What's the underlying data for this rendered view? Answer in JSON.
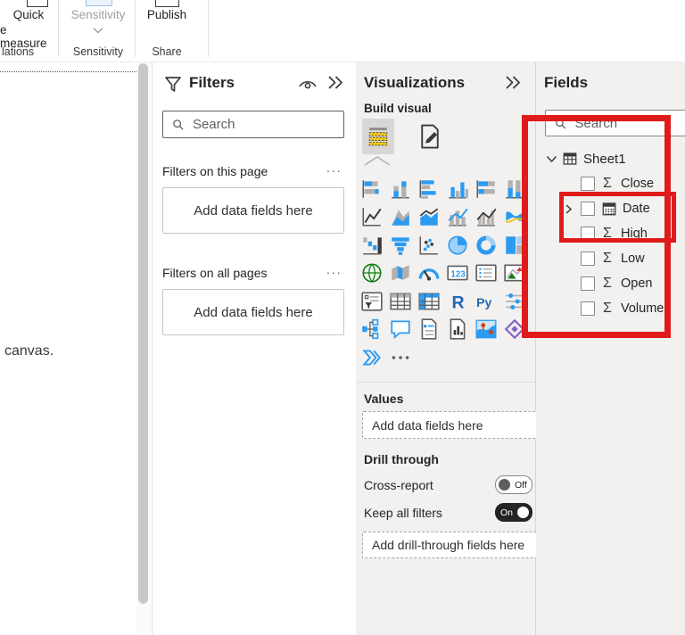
{
  "ribbon": {
    "quick_measure": {
      "line1": "Quick",
      "line2": "e measure"
    },
    "sensitivity_label": "Sensitivity",
    "publish_label": "Publish",
    "group_calculations": "lations",
    "group_sensitivity": "Sensitivity",
    "group_share": "Share"
  },
  "canvas": {
    "text": "canvas."
  },
  "filters": {
    "title": "Filters",
    "search_placeholder": "Search",
    "section_page": {
      "label": "Filters on this page",
      "more": "...",
      "dropzone": "Add data fields here"
    },
    "section_all": {
      "label": "Filters on all pages",
      "more": "...",
      "dropzone": "Add data fields here"
    }
  },
  "visualizations": {
    "title": "Visualizations",
    "build_visual_label": "Build visual",
    "tabs": [
      {
        "name": "build-visual-tab",
        "selected": true
      },
      {
        "name": "format-visual-tab",
        "selected": false
      }
    ],
    "gallery": [
      "stacked-bar-chart",
      "stacked-column-chart",
      "clustered-bar-chart",
      "clustered-column-chart",
      "pct-stacked-bar-chart",
      "pct-stacked-column-chart",
      "line-chart",
      "area-chart",
      "stacked-area-chart",
      "line-stacked-column-chart",
      "line-clustered-column-chart",
      "ribbon-chart",
      "waterfall-chart",
      "funnel-chart",
      "scatter-chart",
      "pie-chart",
      "donut-chart",
      "treemap",
      "map",
      "filled-map",
      "gauge",
      "card",
      "multi-row-card",
      "kpi",
      "slicer",
      "table",
      "matrix",
      "r-script-visual",
      "python-visual",
      "key-influencers",
      "decomposition-tree",
      "qa-visual",
      "smart-narrative",
      "paginated-report",
      "arcgis-map",
      "power-apps",
      "power-automate",
      "more-visuals"
    ],
    "values_label": "Values",
    "values_dropzone": "Add data fields here",
    "drill_through_label": "Drill through",
    "cross_report_label": "Cross-report",
    "cross_report_state": "Off",
    "keep_all_filters_label": "Keep all filters",
    "keep_all_filters_state": "On",
    "drill_dropzone": "Add drill-through fields here"
  },
  "fields": {
    "title": "Fields",
    "search_placeholder": "Search",
    "table_name": "Sheet1",
    "items": [
      {
        "label": "Close",
        "icon": "sigma-icon",
        "expandable": false,
        "checked": false
      },
      {
        "label": "Date",
        "icon": "calendar-icon",
        "expandable": true,
        "checked": false
      },
      {
        "label": "High",
        "icon": "sigma-icon",
        "expandable": false,
        "checked": false
      },
      {
        "label": "Low",
        "icon": "sigma-icon",
        "expandable": false,
        "checked": false
      },
      {
        "label": "Open",
        "icon": "sigma-icon",
        "expandable": false,
        "checked": false
      },
      {
        "label": "Volume",
        "icon": "sigma-icon",
        "expandable": false,
        "checked": false
      }
    ]
  },
  "annotations": {
    "red_color": "#e01b1b",
    "accent_yellow": "#f2c811",
    "toggle_on_color": "#252423"
  }
}
